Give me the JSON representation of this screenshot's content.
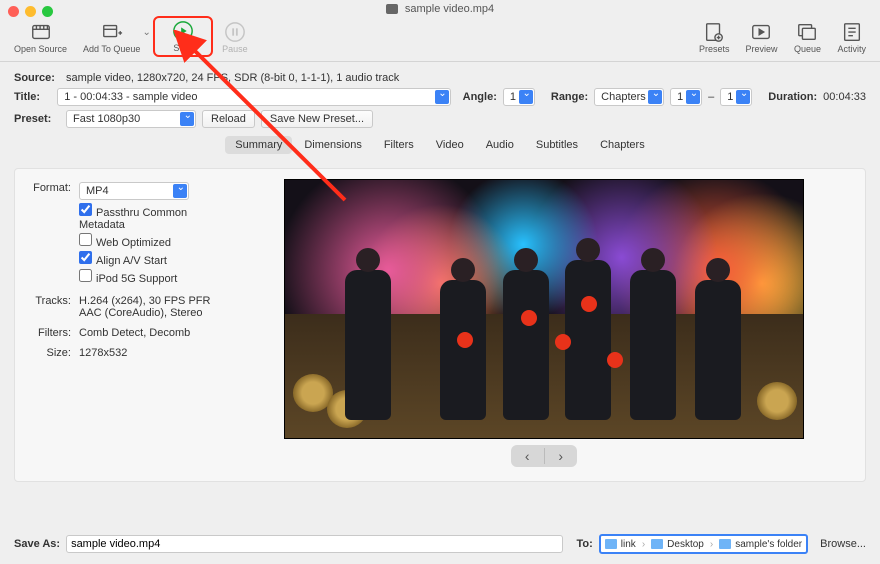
{
  "window": {
    "title": "sample video.mp4"
  },
  "toolbar": {
    "open_source": "Open Source",
    "add_queue": "Add To Queue",
    "start": "Start",
    "pause": "Pause",
    "presets": "Presets",
    "preview": "Preview",
    "queue": "Queue",
    "activity": "Activity"
  },
  "source": {
    "label": "Source:",
    "value": "sample video, 1280x720, 24 FPS, SDR (8-bit 0, 1-1-1), 1 audio track"
  },
  "title": {
    "label": "Title:",
    "value": "1 - 00:04:33 - sample video"
  },
  "angle": {
    "label": "Angle:",
    "value": "1"
  },
  "range": {
    "label": "Range:",
    "mode": "Chapters",
    "from": "1",
    "to": "1",
    "dash": "–"
  },
  "duration": {
    "label": "Duration:",
    "value": "00:04:33"
  },
  "preset": {
    "label": "Preset:",
    "value": "Fast 1080p30",
    "reload": "Reload",
    "save": "Save New Preset..."
  },
  "tabs": {
    "summary": "Summary",
    "dimensions": "Dimensions",
    "filters": "Filters",
    "video": "Video",
    "audio": "Audio",
    "subtitles": "Subtitles",
    "chapters": "Chapters"
  },
  "summary": {
    "format_label": "Format:",
    "format_value": "MP4",
    "check_metadata": "Passthru Common Metadata",
    "check_web": "Web Optimized",
    "check_align": "Align A/V Start",
    "check_ipod": "iPod 5G Support",
    "tracks_label": "Tracks:",
    "tracks_value1": "H.264 (x264), 30 FPS PFR",
    "tracks_value2": "AAC (CoreAudio), Stereo",
    "filters_label": "Filters:",
    "filters_value": "Comb Detect, Decomb",
    "size_label": "Size:",
    "size_value": "1278x532"
  },
  "saveas": {
    "label": "Save As:",
    "value": "sample video.mp4",
    "to": "To:",
    "path1": "link",
    "path2": "Desktop",
    "path3": "sample's folder",
    "browse": "Browse..."
  }
}
